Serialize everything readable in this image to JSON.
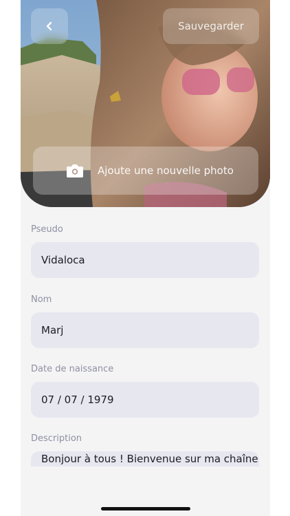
{
  "header": {
    "back_icon": "chevron-left-icon",
    "save_label": "Sauvegarder"
  },
  "photo": {
    "add_label": "Ajoute une nouvelle photo",
    "camera_icon": "camera-icon"
  },
  "form": {
    "pseudo": {
      "label": "Pseudo",
      "value": "Vidaloca"
    },
    "nom": {
      "label": "Nom",
      "value": "Marj"
    },
    "birthdate": {
      "label": "Date de naissance",
      "value": "07 / 07 / 1979"
    },
    "description": {
      "label": "Description",
      "value": "Bonjour à tous ! Bienvenue sur ma chaîne"
    }
  },
  "colors": {
    "background": "#f4f4f5",
    "field_bg": "#e6e7ef",
    "label": "#8f8fa3",
    "text": "#1c1c24"
  }
}
